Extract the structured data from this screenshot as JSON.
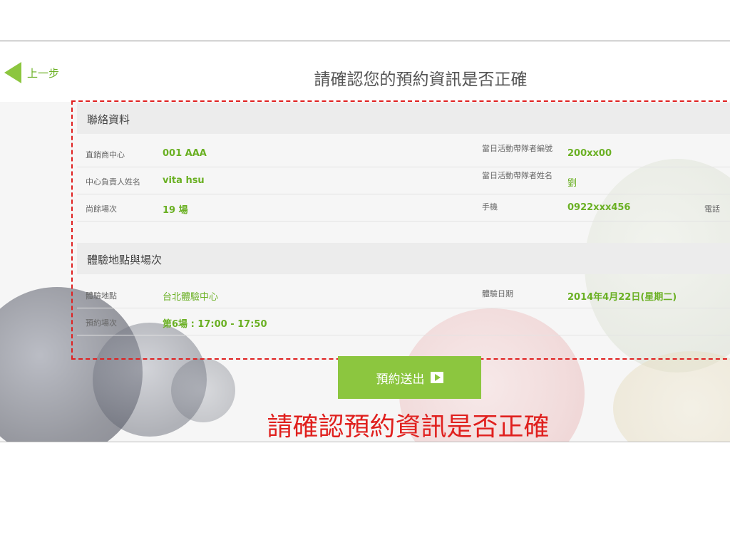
{
  "nav": {
    "back_label": "上一步"
  },
  "page_title": "請確認您的預約資訊是否正確",
  "contact": {
    "section_title": "聯絡資料",
    "rows": [
      {
        "label": "直銷商中心",
        "value": "001 AAA",
        "label2": "當日活動帶隊者編號",
        "value2": "200xx00"
      },
      {
        "label": "中心負責人姓名",
        "value": "vita hsu",
        "label2": "當日活動帶隊者姓名",
        "value2": "劉"
      },
      {
        "label": "尚餘場次",
        "value": "19 場",
        "label2": "手機",
        "value2": "0922xxx456",
        "label3": "電話"
      }
    ]
  },
  "venue": {
    "section_title": "體驗地點與場次",
    "rows": [
      {
        "label": "體驗地點",
        "value": "台北體驗中心",
        "label2": "體驗日期",
        "value2": "2014年4月22日(星期二)"
      },
      {
        "label": "預約場次",
        "value": "第6場 : 17:00 - 17:50"
      }
    ]
  },
  "submit_label": "預約送出",
  "caption": "請確認預約資訊是否正確",
  "colors": {
    "accent": "#8cc63f",
    "value_text": "#6ab023",
    "annotation": "#e02020"
  }
}
